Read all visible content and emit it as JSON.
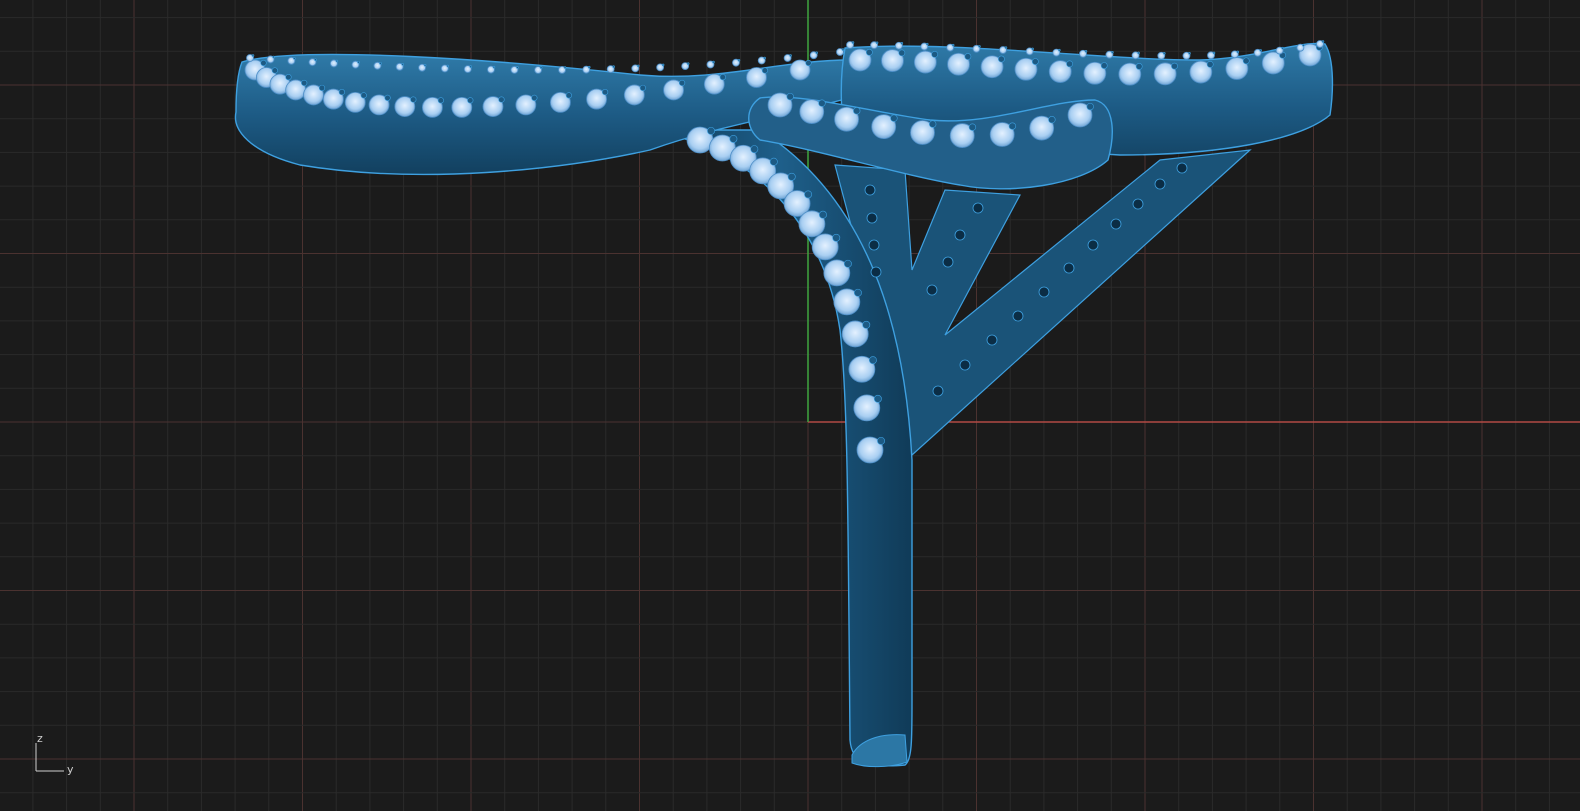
{
  "viewport": {
    "background": "#1b1b1b",
    "minor_grid_color": "#2b2b2b",
    "major_grid_color": "#4b3230",
    "x_axis_color": "#b24a44",
    "z_axis_color": "#3fa63f",
    "model_color": "#1e5a82",
    "model_edge_color": "#3ea0e0",
    "gem_color": "#b9d9f5",
    "axis_widget": {
      "vertical_label": "z",
      "horizontal_label": "y"
    }
  }
}
